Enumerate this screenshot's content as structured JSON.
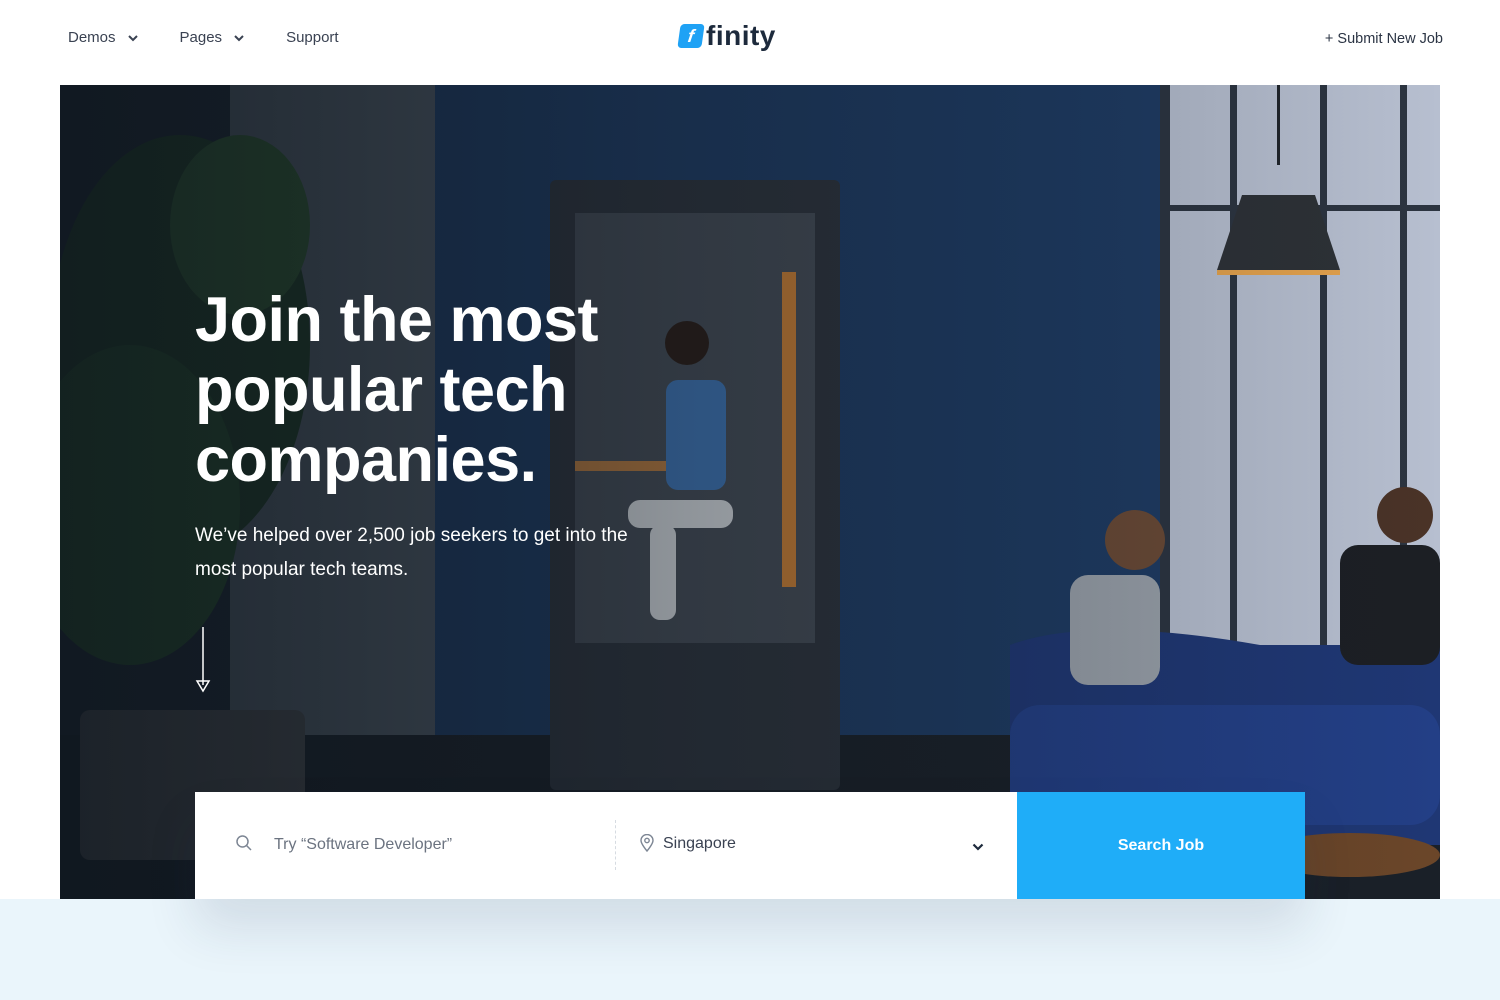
{
  "header": {
    "logo_letter": "f",
    "logo_text": "finity",
    "nav": [
      {
        "label": "Demos",
        "icon": "chevron-down-icon"
      },
      {
        "label": "Pages",
        "icon": "chevron-down-icon"
      },
      {
        "label": "Support"
      }
    ],
    "submit_job_label": "+ Submit New Job"
  },
  "hero": {
    "title": "Join the most popular tech companies.",
    "subtitle": "We’ve helped over 2,500 job seekers to get into the most popular tech teams.",
    "scroll_icon": "arrow-down-icon"
  },
  "search": {
    "keyword_placeholder": "Try “Software Developer”",
    "location_value": "Singapore",
    "button_label": "Search Job"
  },
  "colors": {
    "accent": "#1FADF8",
    "text_dark": "#2B3444",
    "band": "#EAF5FB"
  }
}
